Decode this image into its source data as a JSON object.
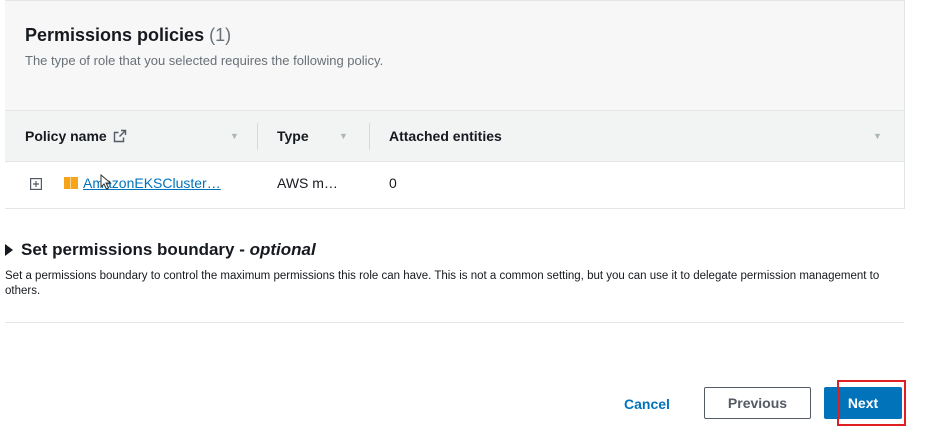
{
  "permissions": {
    "title": "Permissions policies",
    "count": "(1)",
    "description": "The type of role that you selected requires the following policy.",
    "columns": {
      "policy_name": "Policy name",
      "type": "Type",
      "attached_entities": "Attached entities"
    },
    "rows": [
      {
        "policy_name": "AmazonEKSCluster…",
        "type": "AWS m…",
        "attached_entities": "0"
      }
    ]
  },
  "boundary": {
    "title": "Set permissions boundary - ",
    "title_optional": "optional",
    "description": "Set a permissions boundary to control the maximum permissions this role can have. This is not a common setting, but you can use it to delegate permission management to others."
  },
  "footer": {
    "cancel_label": "Cancel",
    "previous_label": "Previous",
    "next_label": "Next"
  },
  "icons": {
    "external_link": "external-link-icon",
    "expand": "plus-square-icon",
    "policy": "aws-policy-cube-icon",
    "sort": "sort-caret-down-icon",
    "disclosure": "caret-right-icon"
  },
  "colors": {
    "link": "#0073bb",
    "primary_button": "#0073bb",
    "highlight": "#e02020",
    "policy_icon": "#f7a41d"
  }
}
